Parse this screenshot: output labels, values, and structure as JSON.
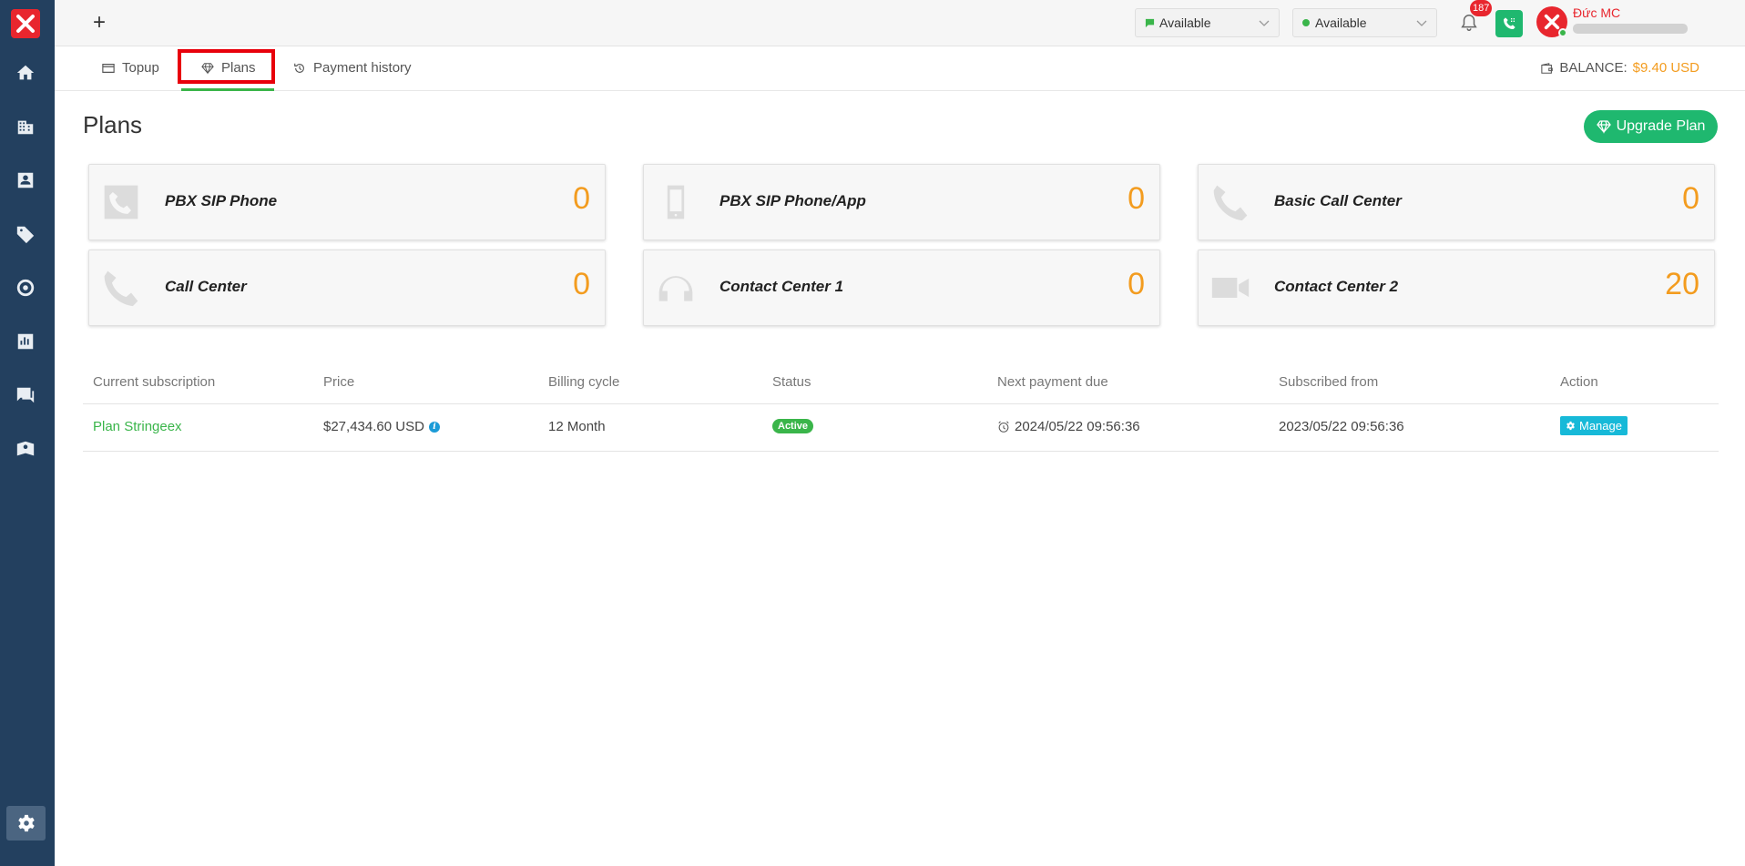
{
  "sidebar": {
    "logo_icon": "stringee-x-logo",
    "items": [
      {
        "icon": "home-icon"
      },
      {
        "icon": "building-icon"
      },
      {
        "icon": "contact-card-icon"
      },
      {
        "icon": "tag-icon"
      },
      {
        "icon": "target-icon"
      },
      {
        "icon": "bar-chart-icon"
      },
      {
        "icon": "chat-icon"
      },
      {
        "icon": "book-user-icon"
      }
    ],
    "settings_icon": "gear-icon"
  },
  "topbar": {
    "add_label": "+",
    "chat_status": "Available",
    "call_status": "Available",
    "notification_count": "187",
    "user_name": "Đức MC"
  },
  "tabs": {
    "topup": "Topup",
    "plans": "Plans",
    "payment_history": "Payment history",
    "balance_label": "BALANCE:",
    "balance_value": "$9.40 USD"
  },
  "page": {
    "title": "Plans",
    "upgrade_label": "Upgrade Plan"
  },
  "plans": [
    {
      "name": "PBX SIP Phone",
      "count": "0",
      "icon": "phone-box-icon"
    },
    {
      "name": "PBX SIP Phone/App",
      "count": "0",
      "icon": "mobile-icon"
    },
    {
      "name": "Basic Call Center",
      "count": "0",
      "icon": "phone-icon"
    },
    {
      "name": "Call Center",
      "count": "0",
      "icon": "phone-icon"
    },
    {
      "name": "Contact Center 1",
      "count": "0",
      "icon": "headphones-icon"
    },
    {
      "name": "Contact Center 2",
      "count": "20",
      "icon": "video-camera-icon"
    }
  ],
  "table": {
    "headers": [
      "Current subscription",
      "Price",
      "Billing cycle",
      "Status",
      "Next payment due",
      "Subscribed from",
      "Action"
    ],
    "row": {
      "subscription": "Plan Stringeex",
      "price": "$27,434.60 USD",
      "billing_cycle": "12 Month",
      "status": "Active",
      "next_payment": "2024/05/22 09:56:36",
      "subscribed_from": "2023/05/22 09:56:36",
      "action": "Manage"
    }
  },
  "colors": {
    "sidebar": "#23405f",
    "accent_green": "#3ab54a",
    "brand_red": "#e8262e",
    "count_orange": "#f39c1f",
    "manage_cyan": "#17b9d8"
  }
}
